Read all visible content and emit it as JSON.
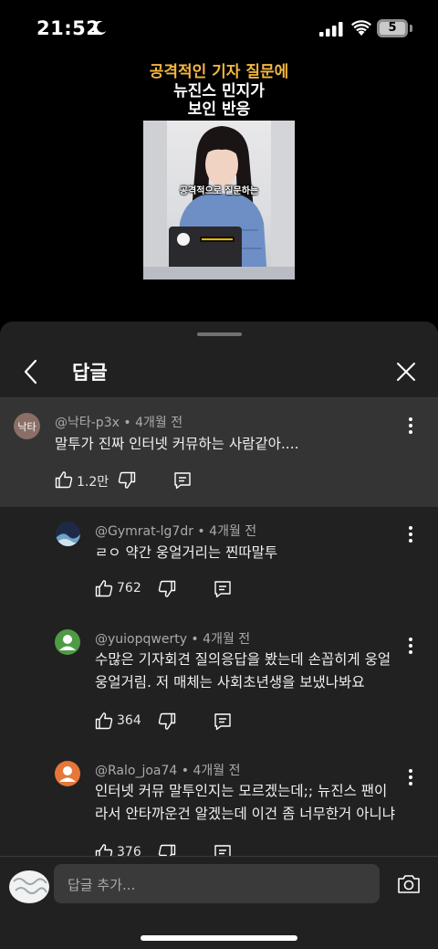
{
  "status_bar": {
    "time": "21:52",
    "battery": "5"
  },
  "video": {
    "caption_line1": "공격적인 기자 질문에",
    "caption_line2": "뉴진스 민지가",
    "caption_line3": "보인 반응",
    "subtitle": "공격적으로 질문하는"
  },
  "sheet": {
    "title": "답글"
  },
  "parent_comment": {
    "avatar_text": "낙타",
    "handle": "@낙타-p3x",
    "time": "4개월 전",
    "text": "말투가 진짜 인터넷 커뮤하는 사람같아....",
    "likes": "1.2만"
  },
  "replies": [
    {
      "handle": "@Gymrat-lg7dr",
      "time": "4개월 전",
      "line1": "ㄹㅇ 약간 웅얼거리는 찐따말투",
      "line2": "",
      "likes": "762"
    },
    {
      "handle": "@yuiopqwerty",
      "time": "4개월 전",
      "line1": "수많은 기자회견 질의응답을 봤는데 손꼽히게 웅얼",
      "line2": "웅얼거림. 저 매체는 사회초년생을 보냈나봐요",
      "likes": "364"
    },
    {
      "handle": "@Ralo_joa74",
      "time": "4개월 전",
      "line1": "인터넷 커뮤 말투인지는 모르겠는데;; 뉴진스 팬이",
      "line2": "라서 안타까운건 알겠는데 이건 좀 너무한거 아니냐",
      "likes": "376"
    }
  ],
  "input": {
    "placeholder": "답글 추가..."
  },
  "colors": {
    "caption_accent": "#f3b640",
    "sheet_bg": "#212121",
    "parent_bg": "#343434"
  }
}
